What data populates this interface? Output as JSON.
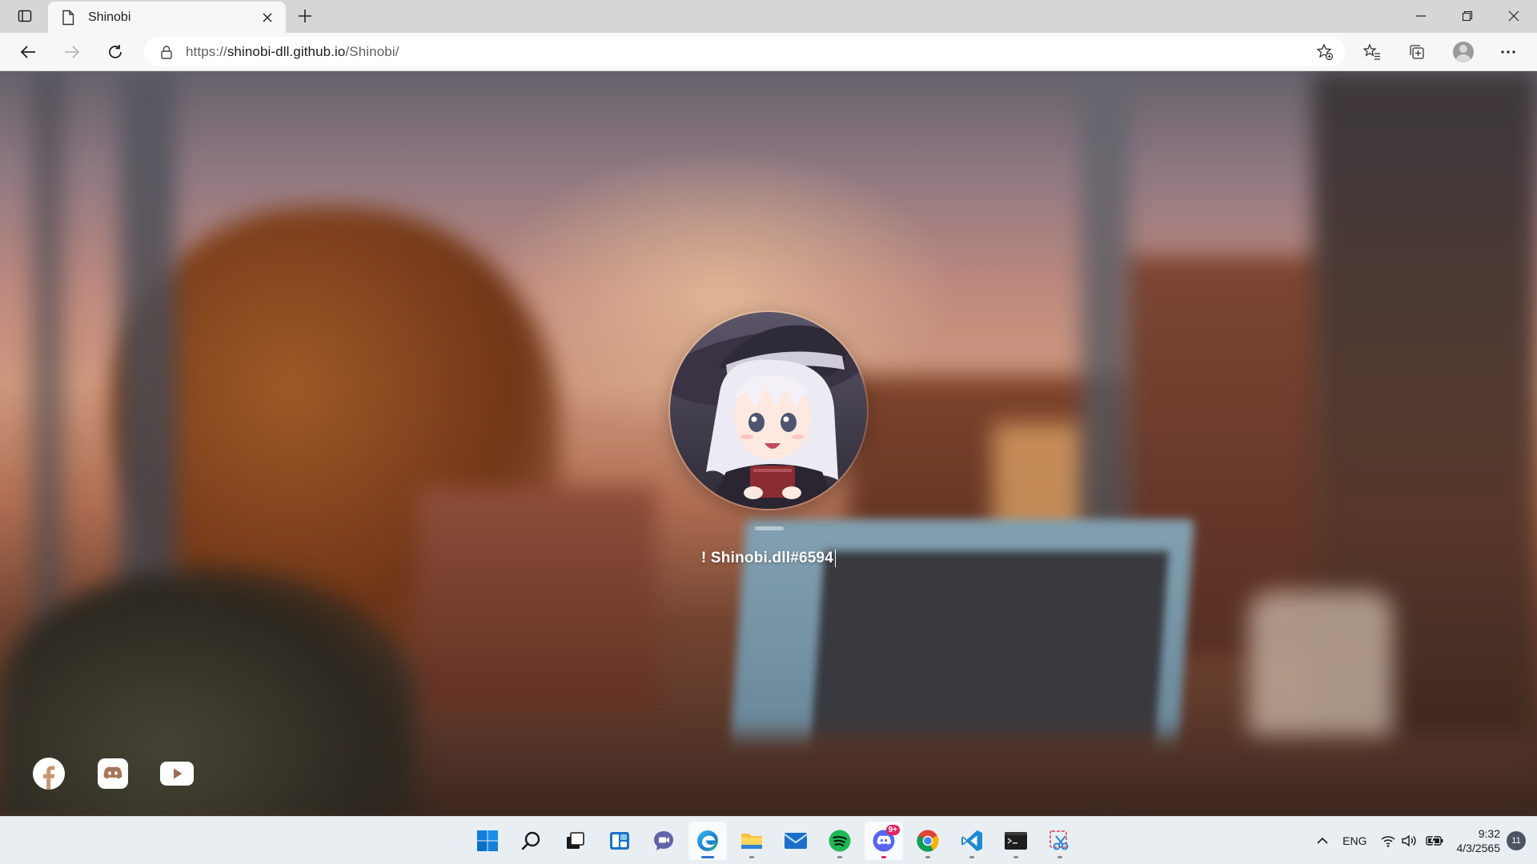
{
  "browser": {
    "tab": {
      "title": "Shinobi"
    },
    "url": {
      "scheme": "https://",
      "host": "shinobi-dll.github.io",
      "path": "/Shinobi/"
    }
  },
  "page": {
    "username": "! Shinobi.dll#6594",
    "socials": [
      "facebook-icon",
      "discord-icon",
      "youtube-icon"
    ]
  },
  "taskbar": {
    "apps": [
      "start",
      "search",
      "task-view",
      "widgets",
      "teams-chat",
      "edge",
      "file-explorer",
      "mail",
      "spotify",
      "discord",
      "chrome",
      "vscode",
      "terminal",
      "snipping-tool"
    ],
    "discord_badge": "9+",
    "language": "ENG",
    "time": "9:32",
    "date": "4/3/2565",
    "notifications": "11"
  },
  "colors": {
    "taskbar_bg": "#e9eef3",
    "titlebar_bg": "#d6d6d6",
    "edge_blue": "#2f6fd1"
  }
}
